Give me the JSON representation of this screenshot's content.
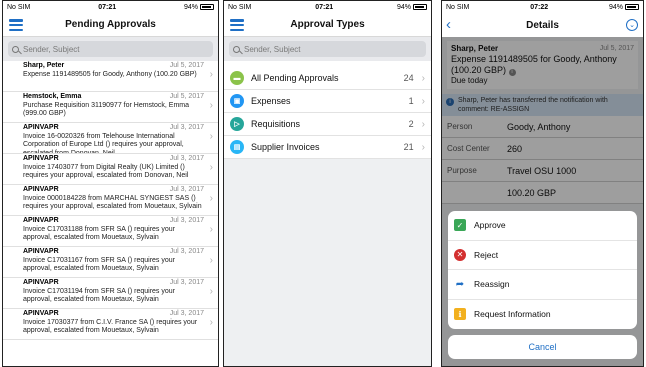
{
  "status_bars": [
    {
      "carrier": "No SIM",
      "time": "07:21",
      "battery": "94%"
    },
    {
      "carrier": "No SIM",
      "time": "07:21",
      "battery": "94%"
    },
    {
      "carrier": "No SIM",
      "time": "07:22",
      "battery": "94%"
    }
  ],
  "pending": {
    "title": "Pending Approvals",
    "search_placeholder": "Sender, Subject",
    "items": [
      {
        "from": "Sharp, Peter",
        "date": "Jul 5, 2017",
        "text": "Expense 1191489505 for Goody, Anthony (100.20 GBP)"
      },
      {
        "from": "Hemstock, Emma",
        "date": "Jul 5, 2017",
        "text": "Purchase Requisition 31190977 for Hemstock, Emma (999.00 GBP)"
      },
      {
        "from": "APINVAPR",
        "date": "Jul 3, 2017",
        "text": "Invoice 16-0020326 from Telehouse International Corporation of Europe Ltd () requires your approval, escalated from Donovan, Neil"
      },
      {
        "from": "APINVAPR",
        "date": "Jul 3, 2017",
        "text": "Invoice 17403077 from Digital Realty (UK) Limited () requires your approval, escalated from Donovan, Neil"
      },
      {
        "from": "APINVAPR",
        "date": "Jul 3, 2017",
        "text": "Invoice 0000184228 from MARCHAL SYNGEST SAS () requires your approval, escalated from Mouetaux, Sylvain"
      },
      {
        "from": "APINVAPR",
        "date": "Jul 3, 2017",
        "text": "Invoice C17031188 from SFR SA () requires your approval, escalated from Mouetaux, Sylvain"
      },
      {
        "from": "APINVAPR",
        "date": "Jul 3, 2017",
        "text": "Invoice C17031167 from SFR SA () requires your approval, escalated from Mouetaux, Sylvain"
      },
      {
        "from": "APINVAPR",
        "date": "Jul 3, 2017",
        "text": "Invoice C17031194 from SFR SA () requires your approval, escalated from Mouetaux, Sylvain"
      },
      {
        "from": "APINVAPR",
        "date": "Jul 3, 2017",
        "text": "Invoice 17030377 from C.I.V. France SA () requires your approval, escalated from Mouetaux, Sylvain"
      }
    ]
  },
  "types": {
    "title": "Approval Types",
    "search_placeholder": "Sender, Subject",
    "items": [
      {
        "label": "All Pending Approvals",
        "count": "24",
        "color": "#8bc34a",
        "icon": "folder-icon"
      },
      {
        "label": "Expenses",
        "count": "1",
        "color": "#2196f3",
        "icon": "expense-icon"
      },
      {
        "label": "Requisitions",
        "count": "2",
        "color": "#26a69a",
        "icon": "cart-icon"
      },
      {
        "label": "Supplier Invoices",
        "count": "21",
        "color": "#29b6f6",
        "icon": "invoice-icon"
      }
    ]
  },
  "details": {
    "title": "Details",
    "from": "Sharp, Peter",
    "date": "Jul 5, 2017",
    "subject": "Expense 1191489505 for Goody, Anthony (100.20 GBP)",
    "due": "Due today",
    "notice": "Sharp, Peter has transferred the notification with comment: RE-ASSIGN",
    "fields": [
      {
        "label": "Person",
        "value": "Goody, Anthony"
      },
      {
        "label": "Cost Center",
        "value": "260"
      },
      {
        "label": "Purpose",
        "value": "Travel OSU 1000"
      },
      {
        "label": "",
        "value": "100.20 GBP"
      }
    ],
    "actions": [
      {
        "label": "Approve",
        "icon": "check-icon",
        "color": "#3aa757"
      },
      {
        "label": "Reject",
        "icon": "reject-icon",
        "color": "#d32f2f"
      },
      {
        "label": "Reassign",
        "icon": "reassign-arrow-icon",
        "color": "#1f6fc5"
      },
      {
        "label": "Request Information",
        "icon": "request-info-icon",
        "color": "#f2b01e"
      }
    ],
    "cancel": "Cancel"
  }
}
